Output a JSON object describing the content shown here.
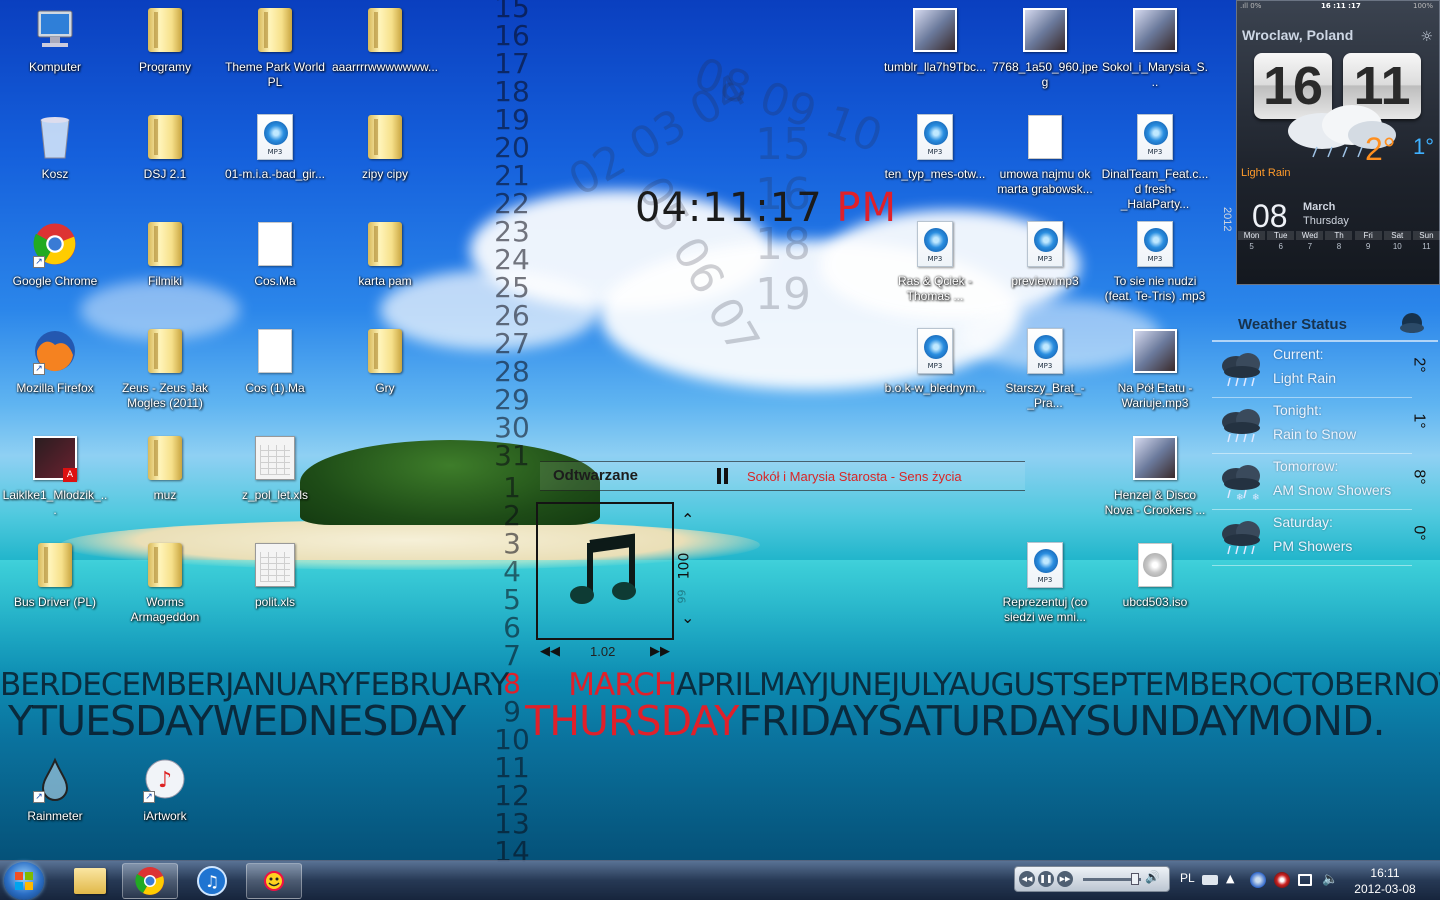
{
  "desktop_icons": [
    {
      "label": "Komputer",
      "type": "computer"
    },
    {
      "label": "Programy",
      "type": "folder"
    },
    {
      "label": "Theme Park World PL",
      "type": "folder"
    },
    {
      "label": "aaarrrrwwwwwww...",
      "type": "folder"
    },
    {
      "label": "Kosz",
      "type": "recycle-bin"
    },
    {
      "label": "DSJ 2.1",
      "type": "folder"
    },
    {
      "label": "01-m.i.a.-bad_gir...",
      "type": "mp3"
    },
    {
      "label": "zipy cipy",
      "type": "folder"
    },
    {
      "label": "Google Chrome",
      "type": "chrome"
    },
    {
      "label": "Filmiki",
      "type": "folder"
    },
    {
      "label": "Cos.Ma",
      "type": "document"
    },
    {
      "label": "karta pam",
      "type": "folder"
    },
    {
      "label": "Mozilla Firefox",
      "type": "firefox"
    },
    {
      "label": "Zeus - Zeus Jak Mogles (2011)",
      "type": "folder"
    },
    {
      "label": "Cos (1).Ma",
      "type": "document"
    },
    {
      "label": "Gry",
      "type": "folder"
    },
    {
      "label": "Laiklke1_Mlodzik_...",
      "type": "pdf"
    },
    {
      "label": "muz",
      "type": "folder"
    },
    {
      "label": "z_pol_let.xls",
      "type": "xls"
    },
    {
      "label": "Bus Driver (PL)",
      "type": "folder"
    },
    {
      "label": "Worms Armageddon",
      "type": "folder"
    },
    {
      "label": "polit.xls",
      "type": "xls"
    },
    {
      "label": "Rainmeter",
      "type": "rainmeter"
    },
    {
      "label": "iArtwork",
      "type": "iartwork"
    },
    {
      "label": "tumblr_lla7h9Tbc...",
      "type": "image"
    },
    {
      "label": "7768_1a50_960.jpeg",
      "type": "image"
    },
    {
      "label": "Sokol_i_Marysia_S...",
      "type": "image"
    },
    {
      "label": "ten_typ_mes-otw...",
      "type": "mp3"
    },
    {
      "label": "umowa najmu ok marta grabowsk...",
      "type": "document"
    },
    {
      "label": "DinalTeam_Feat.c... d fresh-_HalaParty...",
      "type": "mp3"
    },
    {
      "label": "Ras & Qciek - Thomas ...",
      "type": "mp3"
    },
    {
      "label": "preview.mp3",
      "type": "mp3"
    },
    {
      "label": "To sie nie nudzi (feat. Te-Tris) .mp3",
      "type": "mp3"
    },
    {
      "label": "b.o.k-w_blednym...",
      "type": "mp3"
    },
    {
      "label": "Starszy_Brat_-_Pra...",
      "type": "mp3"
    },
    {
      "label": "Na Pół Etatu - Wariuje.mp3",
      "type": "image"
    },
    {
      "label": "Henzel & Disco Nova - Crookers ...",
      "type": "image"
    },
    {
      "label": "Reprezentuj (co siedzi we mni...",
      "type": "mp3"
    },
    {
      "label": "ubcd503.iso",
      "type": "iso"
    }
  ],
  "clock": {
    "time": "04:11:17",
    "ampm": "PM",
    "hours_col": [
      "15",
      "16",
      "17",
      "18",
      "19",
      "20",
      "21",
      "22",
      "23",
      "24",
      "25",
      "26",
      "27",
      "28",
      "29",
      "30",
      "31"
    ],
    "days_col": [
      "1",
      "2",
      "3",
      "4",
      "5",
      "6",
      "7",
      "8",
      "9",
      "10",
      "11",
      "12",
      "13",
      "14"
    ],
    "months_band_left": "BERDECEMBERJANUARYFEBRUARY",
    "months_band_current": "MARCH",
    "months_band_right": "APRILMAYJUNEJULYAUGUSTSEPTEMBEROCTOBERNOVEM",
    "days_band_left": "YTUESDAYWEDNESDAY",
    "days_band_current": "THURSDAY",
    "days_band_right": "FRIDAYSATURDAYSUNDAYMOND.",
    "current_day_num": "8",
    "accent": "#e0202a"
  },
  "player": {
    "label": "Odtwarzane",
    "track": "Sokół i Marysia Starosta - Sens życia",
    "volume": "100",
    "volume_sub": "99",
    "time": "1.02",
    "prev_icon": "rewind-icon",
    "next_icon": "forward-icon"
  },
  "hud": {
    "signal": ".ıll 0%",
    "status_time": "16 :11 :17",
    "battery": "100%",
    "city": "Wroclaw, Poland",
    "hour": "16",
    "minute": "11",
    "temp": "2°",
    "temp_low": "1°",
    "condition": "Light Rain",
    "year": "2012",
    "day": "08",
    "month": "March",
    "weekday": "Thursday",
    "week": [
      {
        "name": "Mon",
        "date": "5"
      },
      {
        "name": "Tue",
        "date": "6"
      },
      {
        "name": "Wed",
        "date": "7"
      },
      {
        "name": "Th",
        "date": "8"
      },
      {
        "name": "Fri",
        "date": "9"
      },
      {
        "name": "Sat",
        "date": "10"
      },
      {
        "name": "Sun",
        "date": "11"
      }
    ]
  },
  "weather_status": {
    "title": "Weather Status",
    "rows": [
      {
        "label": "Current:",
        "value": "Light Rain",
        "temp": "2°"
      },
      {
        "label": "Tonight:",
        "value": "Rain to Snow",
        "temp": "1°"
      },
      {
        "label": "Tomorrow:",
        "value": "AM Snow Showers",
        "temp": "8°"
      },
      {
        "label": "Saturday:",
        "value": "PM Showers",
        "temp": "0°"
      }
    ]
  },
  "taskbar": {
    "apps": [
      {
        "name": "explorer",
        "icon": "folder-icon"
      },
      {
        "name": "chrome",
        "icon": "chrome-icon"
      },
      {
        "name": "itunes",
        "icon": "itunes-icon"
      },
      {
        "name": "sun-app",
        "icon": "sun-icon"
      }
    ],
    "language": "PL",
    "time": "16:11",
    "date": "2012-03-08"
  }
}
